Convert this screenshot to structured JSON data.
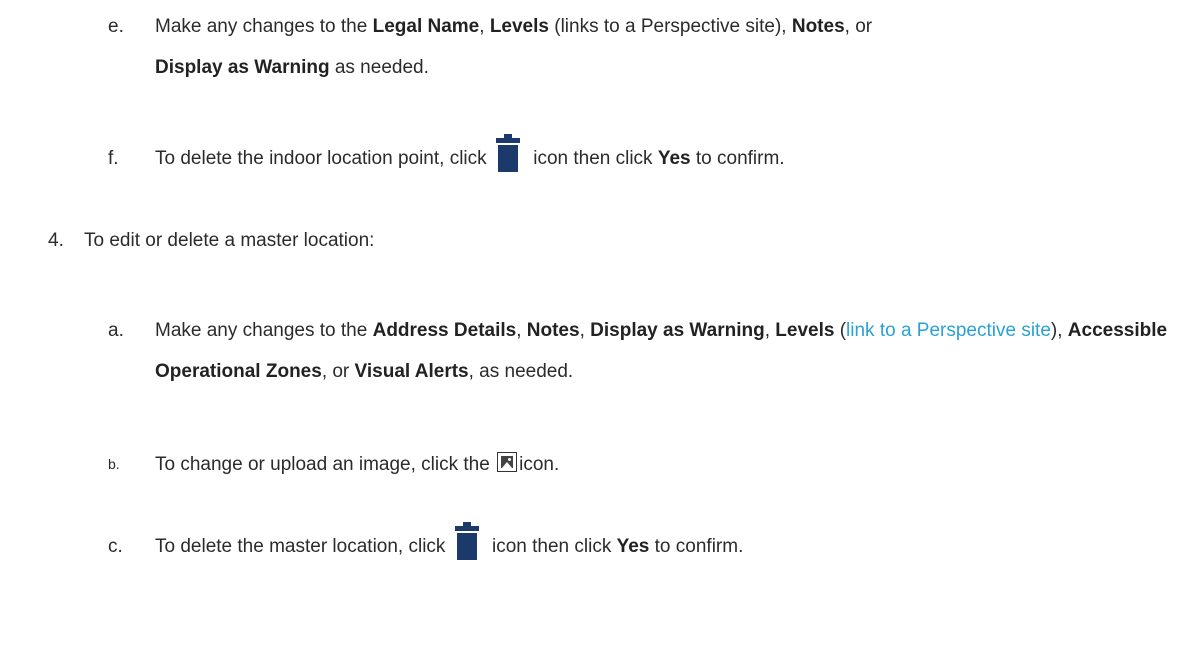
{
  "item_e": {
    "marker": "e.",
    "t1": "Make any changes to the ",
    "b1": "Legal Name",
    "t2": ", ",
    "b2": "Levels",
    "t3": " (links to a Perspective site), ",
    "b3": "Notes",
    "t4": ", or ",
    "b4": "Display as Warning",
    "t5": " as needed."
  },
  "item_f": {
    "marker": "f.",
    "t1": "To delete the indoor location point, click ",
    "icon": "trash-icon",
    "t2": " icon then click ",
    "b1": "Yes",
    "t3": " to confirm."
  },
  "item_4": {
    "marker": "4.",
    "text": "To edit or delete a master location:"
  },
  "item_a": {
    "marker": "a.",
    "t1": "Make any changes to the ",
    "b1": "Address Details",
    "t2": ", ",
    "b2": "Notes",
    "t3": ", ",
    "b3": "Display as Warning",
    "t4": ", ",
    "b4": "Levels",
    "t5": " (",
    "link": "link to a Perspective site",
    "t6": "), ",
    "b5": "Accessible Operational Zones",
    "t7": ", or ",
    "b6": "Visual Alerts",
    "t8": ", as needed."
  },
  "item_b": {
    "marker": "b.",
    "t1": "To change or upload an image, click the ",
    "icon": "image-icon",
    "t2": "icon."
  },
  "item_c": {
    "marker": "c.",
    "t1": "To delete the master location, click ",
    "icon": "trash-icon",
    "t2": " icon then click ",
    "b1": "Yes",
    "t3": " to confirm."
  },
  "colors": {
    "text": "#2b2b2b",
    "link": "#2aa1d6",
    "icon": "#1b3a6b"
  }
}
